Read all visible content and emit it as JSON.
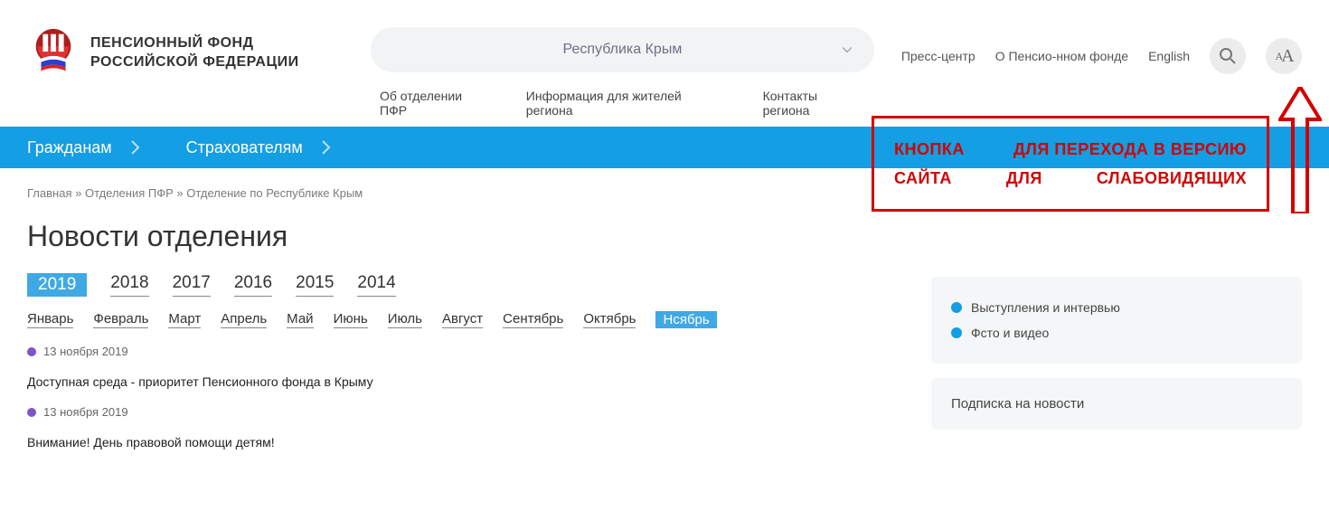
{
  "logo": {
    "line1": "ПЕНСИОННЫЙ ФОНД",
    "line2": "РОССИЙСКОЙ ФЕДЕРАЦИИ"
  },
  "region_selected": "Республика Крым",
  "sub_nav": {
    "about": "Об отделении ПФР",
    "info": "Информация для жителей региона",
    "contacts": "Контакты региона"
  },
  "header_links": {
    "press": "Пресс-центр",
    "about_fund": "О Пенсио-нном фонде",
    "english": "English"
  },
  "main_nav": {
    "citizens": "Гражданам",
    "insurers": "Страхователям"
  },
  "breadcrumbs": {
    "home": "Главная",
    "sep": " » ",
    "branches": "Отделения ПФР",
    "current": "Отделение по Республике Крым"
  },
  "page_title": "Новости отделения",
  "years": [
    "2019",
    "2018",
    "2017",
    "2016",
    "2015",
    "2014"
  ],
  "year_active": "2019",
  "months": [
    "Январь",
    "Февраль",
    "Март",
    "Апрель",
    "Май",
    "Июнь",
    "Июль",
    "Август",
    "Сентябрь",
    "Октябрь",
    "Нсябрь"
  ],
  "month_active": "Нсябрь",
  "news": [
    {
      "date": "13 ноября 2019",
      "title": "Доступная среда - приоритет Пенсионного фонда в Крыму"
    },
    {
      "date": "13 ноября 2019",
      "title": "Внимание! День правовой помощи детям!"
    }
  ],
  "sidebar": {
    "links": [
      "Выступления и интервью",
      "Фсто и видео"
    ],
    "subscribe_title": "Подписка на новости"
  },
  "annotation": {
    "l1a": "КНОПКА",
    "l1b": "ДЛЯ ПЕРЕХОДА В ВЕРСИЮ",
    "l2a": "САЙТА",
    "l2b": "ДЛЯ",
    "l2c": "СЛАБОВИДЯЩИХ"
  }
}
